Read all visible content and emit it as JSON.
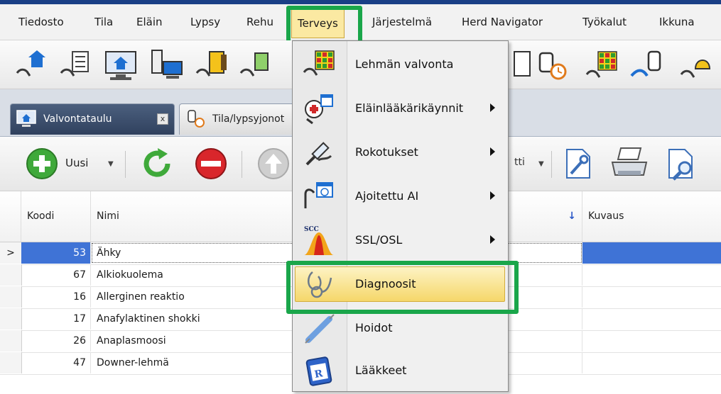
{
  "menubar": {
    "items": [
      "Tiedosto",
      "Tila",
      "Eläin",
      "Lypsy",
      "Rehu",
      "Terveys",
      "Järjestelmä",
      "Herd Navigator",
      "Työkalut",
      "Ikkuna"
    ],
    "active": "Terveys"
  },
  "tabs": [
    {
      "label": "Valvontataulu",
      "close": "x",
      "icon": "home-monitor-icon"
    },
    {
      "label": "Tila/lypsyjonot",
      "icon": "milk-clock-icon"
    }
  ],
  "toolbar": {
    "new_label": "Uusi",
    "report_label": "tti"
  },
  "grid": {
    "columns": [
      "Koodi",
      "Nimi",
      "Kuvaus"
    ],
    "sort_indicator": "↓",
    "current_row_marker": ">",
    "rows": [
      {
        "code": "53",
        "name": "Ähky"
      },
      {
        "code": "67",
        "name": "Alkiokuolema"
      },
      {
        "code": "16",
        "name": "Allerginen reaktio"
      },
      {
        "code": "17",
        "name": "Anafylaktinen shokki"
      },
      {
        "code": "26",
        "name": "Anaplasmoosi"
      },
      {
        "code": "47",
        "name": "Downer-lehmä"
      }
    ]
  },
  "dropdown": {
    "items": [
      {
        "label": "Lehmän valvonta",
        "submenu": false,
        "icon": "cow-monitor-icon"
      },
      {
        "label": "Eläinlääkärikäynnit",
        "submenu": true,
        "icon": "vet-visit-icon"
      },
      {
        "label": "Rokotukset",
        "submenu": true,
        "icon": "vaccination-icon"
      },
      {
        "label": "Ajoitettu AI",
        "submenu": true,
        "icon": "timed-ai-icon"
      },
      {
        "label": "SSL/OSL",
        "submenu": true,
        "icon": "scc-icon",
        "icon_text": "SCC"
      },
      {
        "label": "Diagnoosit",
        "submenu": false,
        "icon": "stethoscope-icon"
      },
      {
        "label": "Hoidot",
        "submenu": false,
        "icon": "syringe-icon"
      },
      {
        "label": "Lääkkeet",
        "submenu": false,
        "icon": "prescription-icon",
        "icon_text": "R"
      }
    ],
    "highlighted": "Diagnoosit"
  },
  "colors": {
    "highlight_green": "#1aa64a",
    "selection_blue": "#3f73d6",
    "menu_hover": "#f5d76a"
  }
}
